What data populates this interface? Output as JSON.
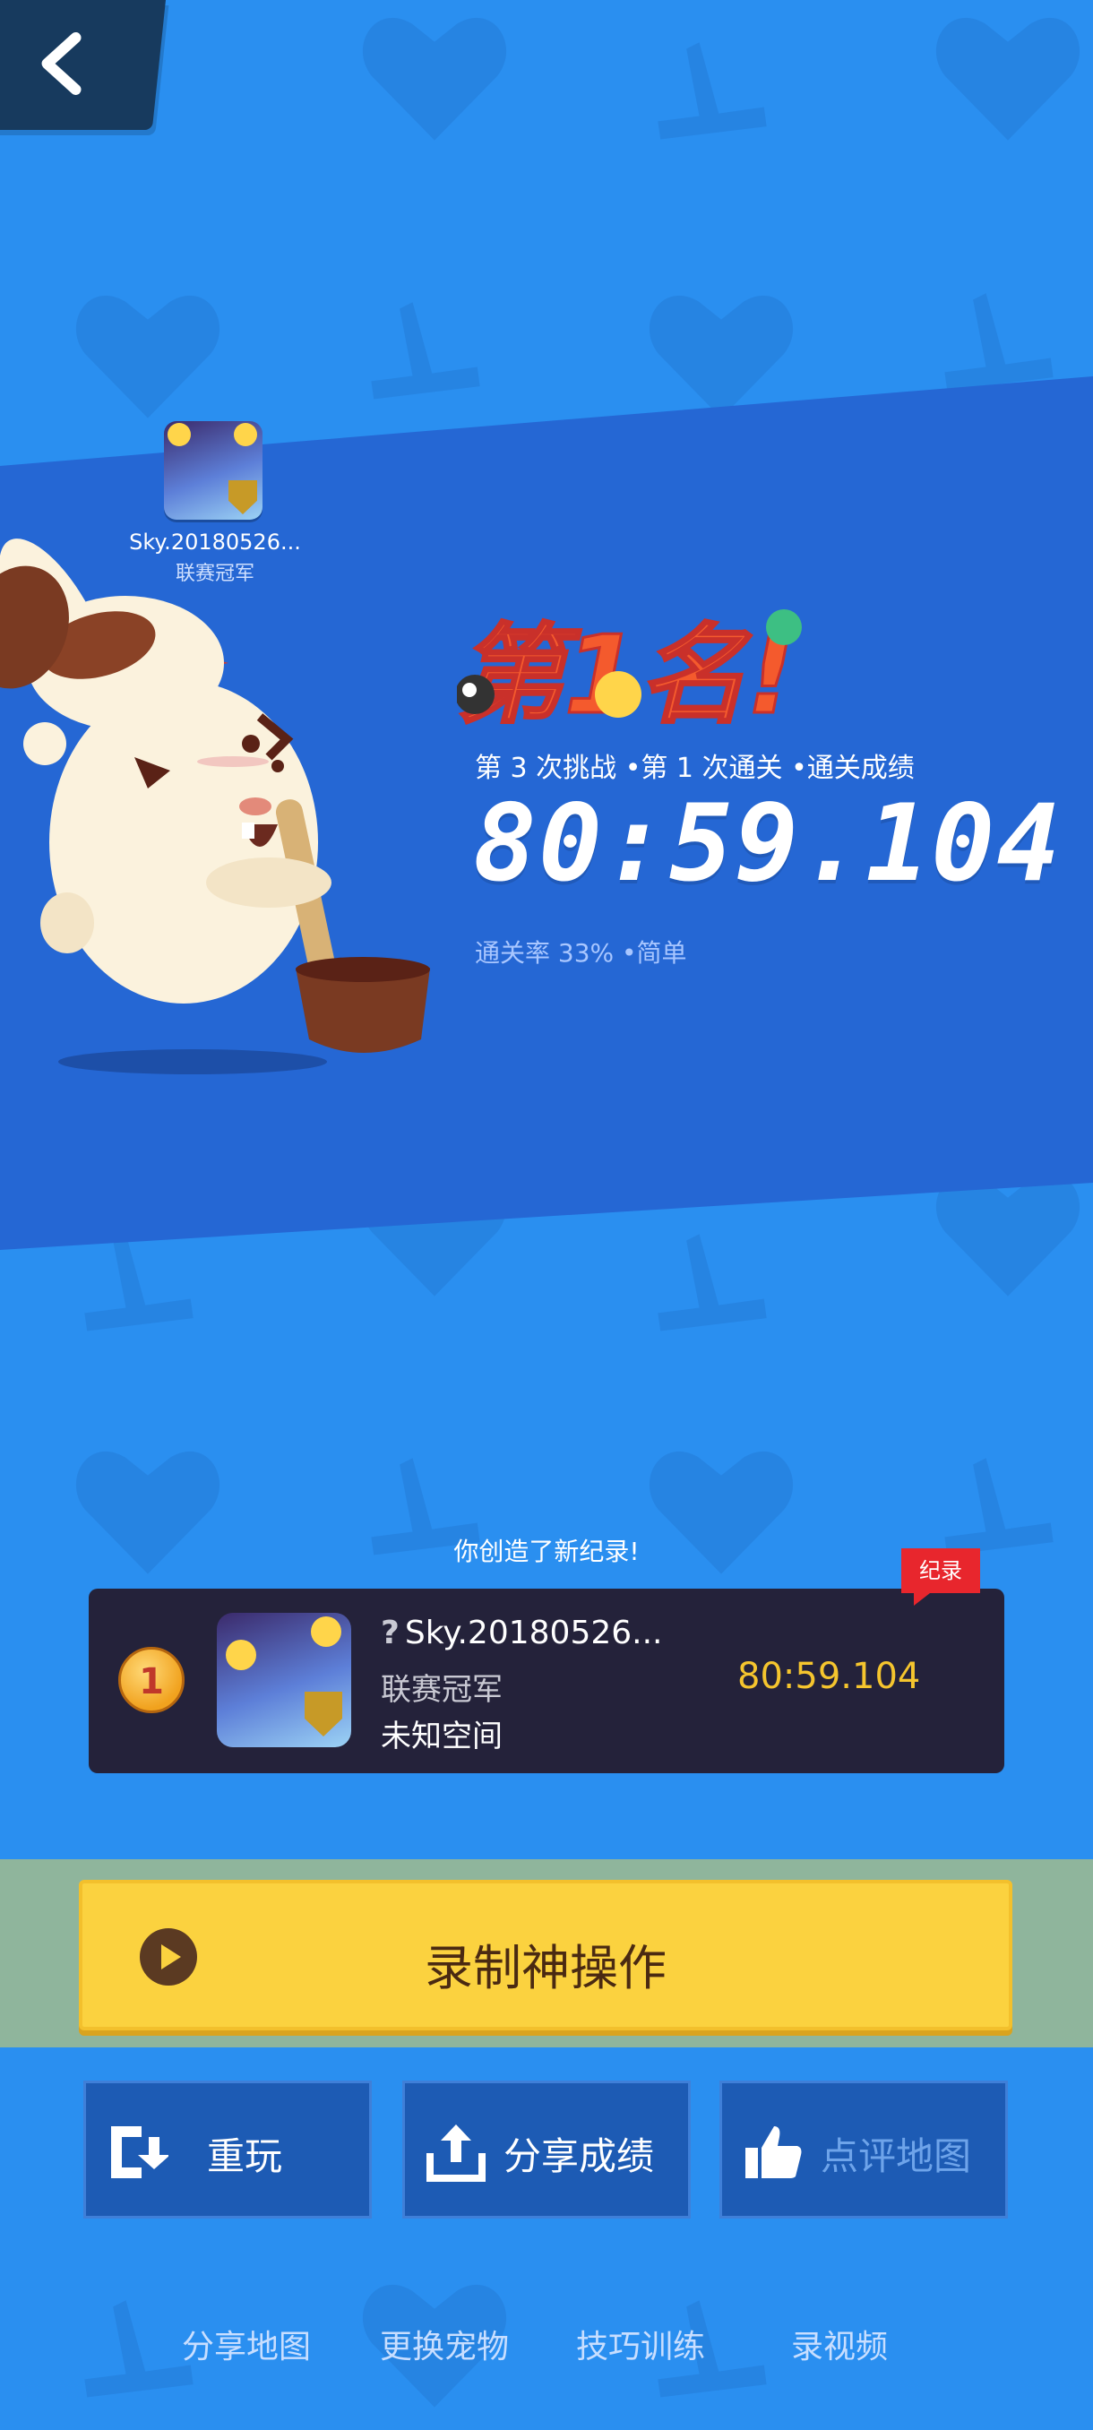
{
  "app": {
    "back_label": "back"
  },
  "map": {
    "name": "Sky.20180526...",
    "category": "联赛冠军"
  },
  "result": {
    "stats": "第 3 次挑战 •第 1 次通关 •通关成绩",
    "time": "80:59.104",
    "rate": "通关率 33% •简单",
    "rank_title": "第1名!"
  },
  "record": {
    "new_record_text": "你创造了新纪录!",
    "tag": "纪录",
    "rank": "1",
    "question_mark": "?",
    "name": "Sky.20180526...",
    "category": "联赛冠军",
    "level": "未知空间",
    "time": "80:59.104"
  },
  "buttons": {
    "record_video": "录制神操作",
    "replay": "重玩",
    "share_score": "分享成绩",
    "review_map": "点评地图"
  },
  "bottom_links": [
    "分享地图",
    "更换宠物",
    "技巧训练",
    "录视频"
  ],
  "colors": {
    "background": "#2a8ff0",
    "banner": "#2567d4",
    "accent_yellow": "#fbd23f",
    "time_gold": "#f5c52e",
    "record_red": "#e8262d"
  }
}
